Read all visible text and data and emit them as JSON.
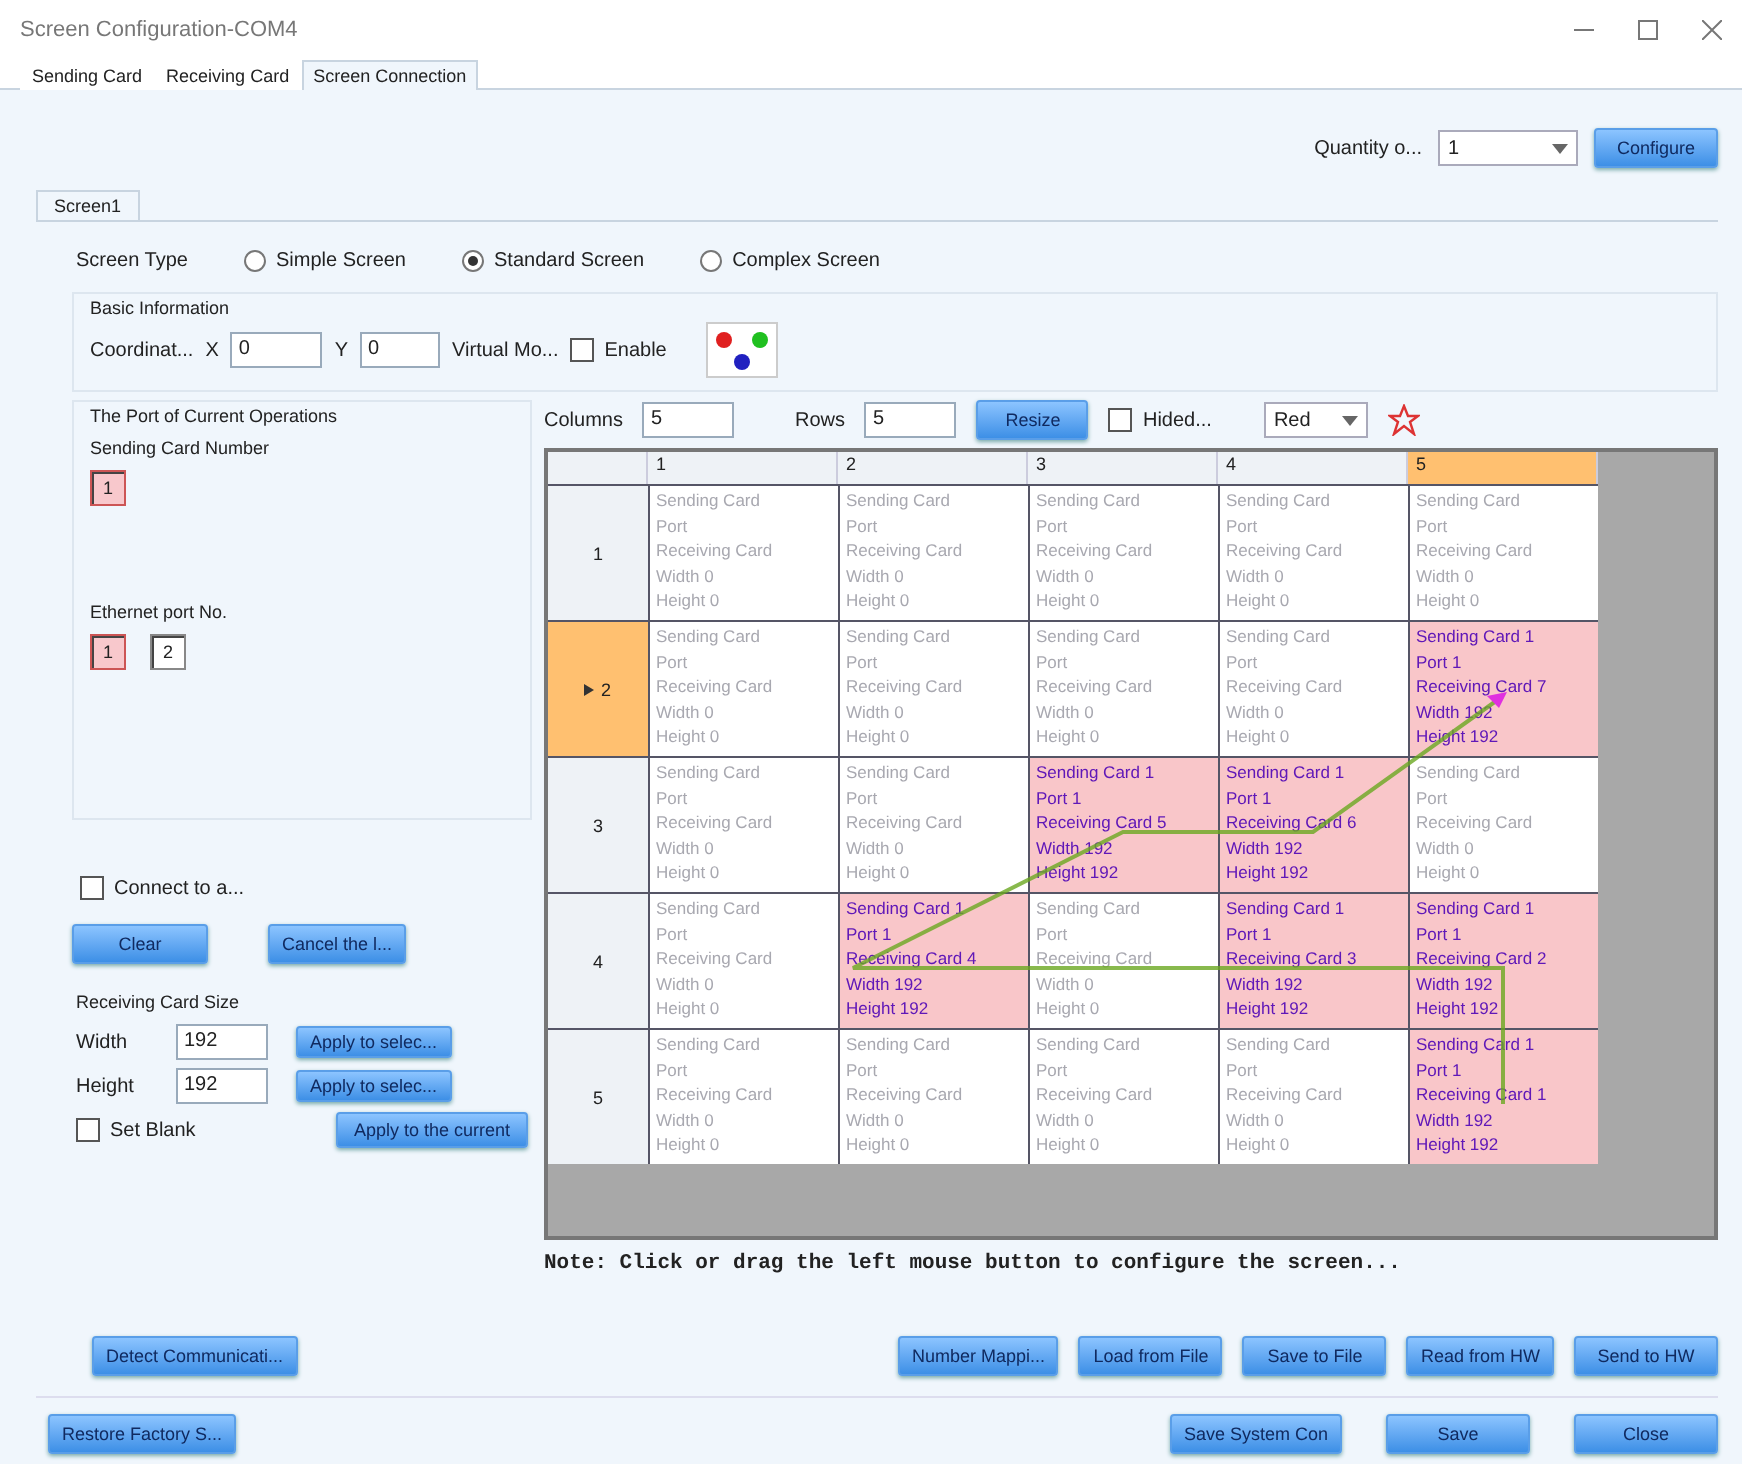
{
  "window": {
    "title": "Screen Configuration-COM4"
  },
  "tabs": [
    {
      "label": "Sending Card",
      "selected": false
    },
    {
      "label": "Receiving Card",
      "selected": false
    },
    {
      "label": "Screen Connection",
      "selected": true
    }
  ],
  "quantity": {
    "label": "Quantity o...",
    "value": "1",
    "button": "Configure"
  },
  "screen_tabs": [
    {
      "label": "Screen1",
      "selected": true
    }
  ],
  "screen_type": {
    "label": "Screen Type",
    "options": [
      {
        "label": "Simple Screen",
        "selected": false
      },
      {
        "label": "Standard Screen",
        "selected": true
      },
      {
        "label": "Complex Screen",
        "selected": false
      }
    ]
  },
  "basic_information": {
    "title": "Basic Information",
    "coordinate_label": "Coordinat...",
    "x_label": "X",
    "x_value": "0",
    "y_label": "Y",
    "y_value": "0",
    "virtual_label": "Virtual Mo...",
    "enable": {
      "label": "Enable",
      "checked": false
    }
  },
  "port": {
    "title": "The Port of Current Operations",
    "sending_card_label": "Sending Card Number",
    "sending_cards": [
      {
        "label": "1",
        "selected": true
      }
    ],
    "ethernet_label": "Ethernet port No.",
    "ports": [
      {
        "label": "1",
        "selected": true
      },
      {
        "label": "2",
        "selected": false
      }
    ]
  },
  "connect": {
    "label": "Connect to a...",
    "checked": false
  },
  "clear_buttons": [
    "Clear",
    "Cancel the l..."
  ],
  "card_size": {
    "title": "Receiving Card Size",
    "width_label": "Width",
    "width_value": "192",
    "height_label": "Height",
    "height_value": "192",
    "apply_width": "Apply to selec...",
    "apply_height": "Apply to selec..."
  },
  "set_blank": {
    "label": "Set Blank",
    "checked": false
  },
  "apply_current": "Apply to the current",
  "grid_toolbar": {
    "columns_label": "Columns",
    "columns_value": "5",
    "rows_label": "Rows",
    "rows_value": "5",
    "resize_button": "Resize",
    "hide": {
      "label": "Hided...",
      "checked": false
    },
    "color_value": "Red"
  },
  "grid": {
    "columns": [
      {
        "label": "1",
        "selected": false
      },
      {
        "label": "2",
        "selected": false
      },
      {
        "label": "3",
        "selected": false
      },
      {
        "label": "4",
        "selected": false
      },
      {
        "label": "5",
        "selected": true
      }
    ],
    "rows": [
      {
        "label": "1",
        "selected": false,
        "cells": [
          {
            "filled": false,
            "lines": [
              "Sending Card",
              "Port",
              "Receiving Card",
              "Width 0",
              "Height 0"
            ]
          },
          {
            "filled": false,
            "lines": [
              "Sending Card",
              "Port",
              "Receiving Card",
              "Width 0",
              "Height 0"
            ]
          },
          {
            "filled": false,
            "lines": [
              "Sending Card",
              "Port",
              "Receiving Card",
              "Width 0",
              "Height 0"
            ]
          },
          {
            "filled": false,
            "lines": [
              "Sending Card",
              "Port",
              "Receiving Card",
              "Width 0",
              "Height 0"
            ]
          },
          {
            "filled": false,
            "lines": [
              "Sending Card",
              "Port",
              "Receiving Card",
              "Width 0",
              "Height 0"
            ]
          }
        ]
      },
      {
        "label": "2",
        "selected": true,
        "cells": [
          {
            "filled": false,
            "lines": [
              "Sending Card",
              "Port",
              "Receiving Card",
              "Width 0",
              "Height 0"
            ]
          },
          {
            "filled": false,
            "lines": [
              "Sending Card",
              "Port",
              "Receiving Card",
              "Width 0",
              "Height 0"
            ]
          },
          {
            "filled": false,
            "lines": [
              "Sending Card",
              "Port",
              "Receiving Card",
              "Width 0",
              "Height 0"
            ]
          },
          {
            "filled": false,
            "lines": [
              "Sending Card",
              "Port",
              "Receiving Card",
              "Width 0",
              "Height 0"
            ]
          },
          {
            "filled": true,
            "lines": [
              "Sending Card 1",
              "Port 1",
              "Receiving Card 7",
              "Width 192",
              "Height 192"
            ]
          }
        ]
      },
      {
        "label": "3",
        "selected": false,
        "cells": [
          {
            "filled": false,
            "lines": [
              "Sending Card",
              "Port",
              "Receiving Card",
              "Width 0",
              "Height 0"
            ]
          },
          {
            "filled": false,
            "lines": [
              "Sending Card",
              "Port",
              "Receiving Card",
              "Width 0",
              "Height 0"
            ]
          },
          {
            "filled": true,
            "lines": [
              "Sending Card 1",
              "Port 1",
              "Receiving Card 5",
              "Width 192",
              "Height 192"
            ]
          },
          {
            "filled": true,
            "lines": [
              "Sending Card 1",
              "Port 1",
              "Receiving Card 6",
              "Width 192",
              "Height 192"
            ]
          },
          {
            "filled": false,
            "lines": [
              "Sending Card",
              "Port",
              "Receiving Card",
              "Width 0",
              "Height 0"
            ]
          }
        ]
      },
      {
        "label": "4",
        "selected": false,
        "cells": [
          {
            "filled": false,
            "lines": [
              "Sending Card",
              "Port",
              "Receiving Card",
              "Width 0",
              "Height 0"
            ]
          },
          {
            "filled": true,
            "lines": [
              "Sending Card 1",
              "Port 1",
              "Receiving Card 4",
              "Width 192",
              "Height 192"
            ]
          },
          {
            "filled": false,
            "lines": [
              "Sending Card",
              "Port",
              "Receiving Card",
              "Width 0",
              "Height 0"
            ]
          },
          {
            "filled": true,
            "lines": [
              "Sending Card 1",
              "Port 1",
              "Receiving Card 3",
              "Width 192",
              "Height 192"
            ]
          },
          {
            "filled": true,
            "lines": [
              "Sending Card 1",
              "Port 1",
              "Receiving Card 2",
              "Width 192",
              "Height 192"
            ]
          }
        ]
      },
      {
        "label": "5",
        "selected": false,
        "cells": [
          {
            "filled": false,
            "lines": [
              "Sending Card",
              "Port",
              "Receiving Card",
              "Width 0",
              "Height 0"
            ]
          },
          {
            "filled": false,
            "lines": [
              "Sending Card",
              "Port",
              "Receiving Card",
              "Width 0",
              "Height 0"
            ]
          },
          {
            "filled": false,
            "lines": [
              "Sending Card",
              "Port",
              "Receiving Card",
              "Width 0",
              "Height 0"
            ]
          },
          {
            "filled": false,
            "lines": [
              "Sending Card",
              "Port",
              "Receiving Card",
              "Width 0",
              "Height 0"
            ]
          },
          {
            "filled": true,
            "lines": [
              "Sending Card 1",
              "Port 1",
              "Receiving Card 1",
              "Width 192",
              "Height 192"
            ]
          }
        ]
      }
    ]
  },
  "note": "Note: Click or drag the left mouse button to configure the screen...",
  "action_left": "Detect Communicati...",
  "actions": [
    "Number Mappi...",
    "Load from File",
    "Save to File",
    "Read from HW",
    "Send to HW"
  ],
  "footer_left": "Restore Factory S...",
  "footer_buttons": [
    "Save System Con",
    "Save",
    "Close"
  ]
}
